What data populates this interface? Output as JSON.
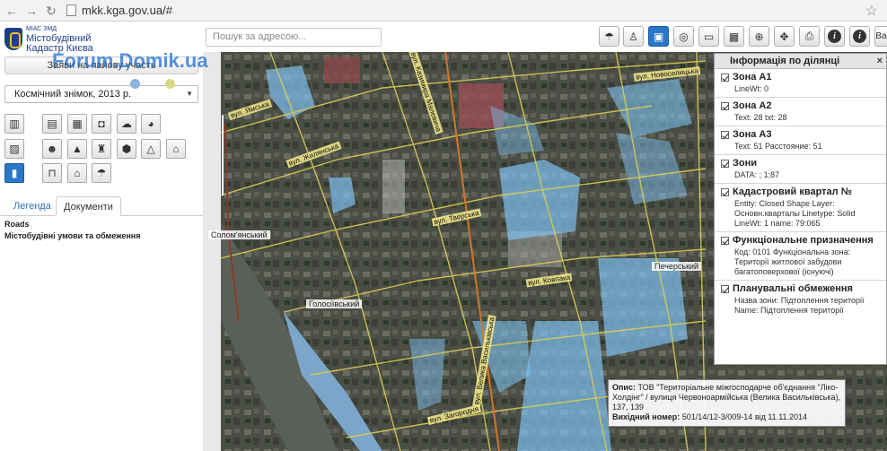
{
  "browser": {
    "url": "mkk.kga.gov.ua/#"
  },
  "logo": {
    "sub": "МІАС ЗМД",
    "line1": "Містобудівний",
    "line2": "Кадастр Києва"
  },
  "watermark": "Forum.Domik.ua",
  "left": {
    "apply_button": "Заяви на пайову участь",
    "layer_select": "Космічний знімок, 2013 р.",
    "tabs": [
      {
        "label": "Легенда"
      },
      {
        "label": "Документи"
      }
    ],
    "roads_label": "Roads",
    "restrictions_label": "Містобудівні умови та обмеження"
  },
  "search": {
    "placeholder": "Пошук за адресою..."
  },
  "toolbar": {
    "last_label": "Ва"
  },
  "info_panel": {
    "title": "Інформація по ділянці",
    "close": "×",
    "sections": [
      {
        "title": "Зона А1",
        "body": "LineWt: 0"
      },
      {
        "title": "Зона А2",
        "body": "Text: 28 txt: 28"
      },
      {
        "title": "Зона А3",
        "body": "Text: 51 Расстояние: 51"
      },
      {
        "title": "Зони",
        "body": "DATA: ; 1;87"
      },
      {
        "title": "Кадастровий квартал №",
        "body": "Entity: Closed Shape Layer: Основн.кварталы Linetype: Solid LineWt: 1 name: 79:065"
      },
      {
        "title": "Функціональне призначення",
        "body": "Код: 0101 Функціональна зона: Території житлової забудови багатоповерхової (існуючі)"
      },
      {
        "title": "Планувальні обмеження",
        "body": "Назва зони: Підтоплення території Name: Підтоплення території"
      }
    ]
  },
  "popup": {
    "label1": "Опис:",
    "text1": "ТОВ \"Територіальне міжгосподарче об'єднання \"Ліко-Холдінг\" / вулиця Червоноармійська (Велика Васильківська), 137, 139",
    "label2": "Вихідний номер:",
    "text2": "501/14/12-3/009-14 від 11.11.2014"
  },
  "map_labels": {
    "solomyanskyi": "Солом'янський",
    "holosiivskyi": "Голосіївський",
    "pecherskyi": "Печерський",
    "streets": [
      "вул. Ямська",
      "вул. Тверська",
      "вул. Казимира Малевича",
      "вул. Велика Васильківська",
      "вул. Ковпака",
      "вул. Загородня",
      "вул. Жилянська",
      "вул. Новоселицька"
    ]
  },
  "colors": {
    "accent": "#2a77c8",
    "zone_fill": "#7fc0f0"
  }
}
